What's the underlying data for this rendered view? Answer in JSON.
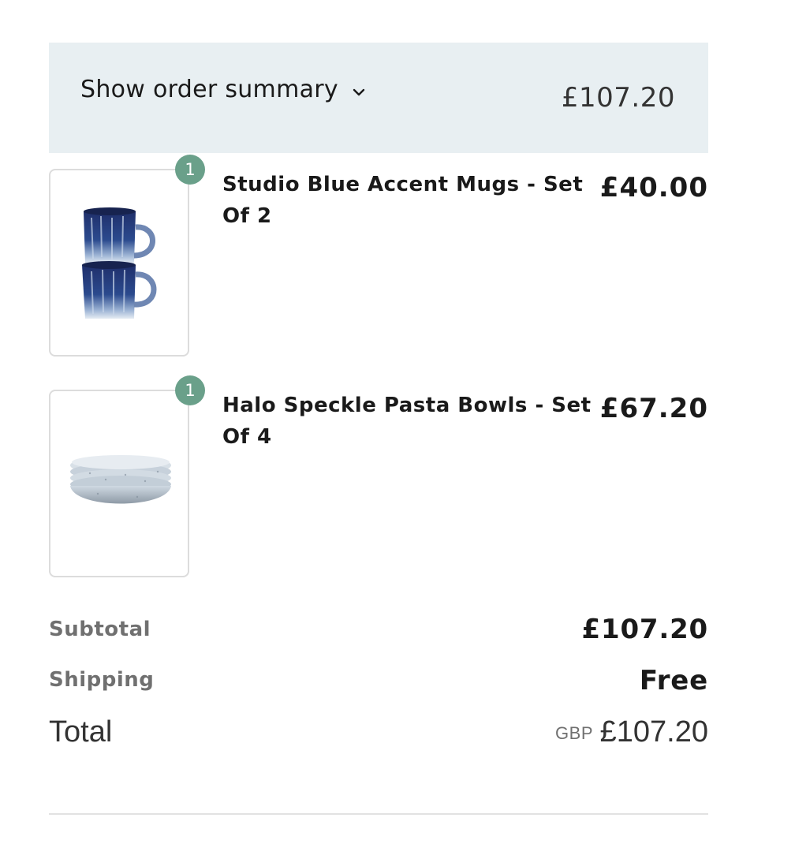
{
  "summary": {
    "toggle_label": "Show order summary",
    "toggle_icon": "chevron-down-icon",
    "total": "£107.20",
    "background": "#e8eff2"
  },
  "items": [
    {
      "name": "Studio Blue Accent Mugs - Set Of 2",
      "quantity": "1",
      "price": "£40.00",
      "image": "blue-mugs-image"
    },
    {
      "name": "Halo Speckle Pasta Bowls - Set Of 4",
      "quantity": "1",
      "price": "£67.20",
      "image": "pasta-bowls-image"
    }
  ],
  "totals": {
    "subtotal_label": "Subtotal",
    "subtotal_value": "£107.20",
    "shipping_label": "Shipping",
    "shipping_value": "Free",
    "total_label": "Total",
    "currency": "GBP",
    "total_value": "£107.20"
  },
  "colors": {
    "badge": "#6aa08a",
    "muted_text": "#707070",
    "thumb_border": "#dcdcdc"
  }
}
